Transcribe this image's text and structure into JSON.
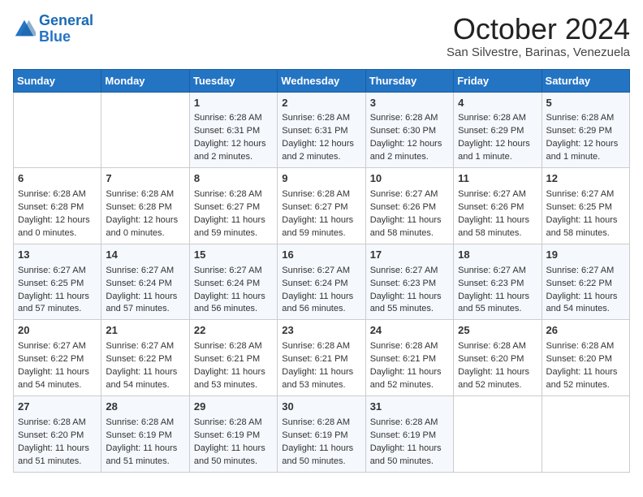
{
  "logo": {
    "line1": "General",
    "line2": "Blue"
  },
  "title": "October 2024",
  "location": "San Silvestre, Barinas, Venezuela",
  "days_header": [
    "Sunday",
    "Monday",
    "Tuesday",
    "Wednesday",
    "Thursday",
    "Friday",
    "Saturday"
  ],
  "weeks": [
    [
      {
        "day": "",
        "data": ""
      },
      {
        "day": "",
        "data": ""
      },
      {
        "day": "1",
        "data": "Sunrise: 6:28 AM\nSunset: 6:31 PM\nDaylight: 12 hours and 2 minutes."
      },
      {
        "day": "2",
        "data": "Sunrise: 6:28 AM\nSunset: 6:31 PM\nDaylight: 12 hours and 2 minutes."
      },
      {
        "day": "3",
        "data": "Sunrise: 6:28 AM\nSunset: 6:30 PM\nDaylight: 12 hours and 2 minutes."
      },
      {
        "day": "4",
        "data": "Sunrise: 6:28 AM\nSunset: 6:29 PM\nDaylight: 12 hours and 1 minute."
      },
      {
        "day": "5",
        "data": "Sunrise: 6:28 AM\nSunset: 6:29 PM\nDaylight: 12 hours and 1 minute."
      }
    ],
    [
      {
        "day": "6",
        "data": "Sunrise: 6:28 AM\nSunset: 6:28 PM\nDaylight: 12 hours and 0 minutes."
      },
      {
        "day": "7",
        "data": "Sunrise: 6:28 AM\nSunset: 6:28 PM\nDaylight: 12 hours and 0 minutes."
      },
      {
        "day": "8",
        "data": "Sunrise: 6:28 AM\nSunset: 6:27 PM\nDaylight: 11 hours and 59 minutes."
      },
      {
        "day": "9",
        "data": "Sunrise: 6:28 AM\nSunset: 6:27 PM\nDaylight: 11 hours and 59 minutes."
      },
      {
        "day": "10",
        "data": "Sunrise: 6:27 AM\nSunset: 6:26 PM\nDaylight: 11 hours and 58 minutes."
      },
      {
        "day": "11",
        "data": "Sunrise: 6:27 AM\nSunset: 6:26 PM\nDaylight: 11 hours and 58 minutes."
      },
      {
        "day": "12",
        "data": "Sunrise: 6:27 AM\nSunset: 6:25 PM\nDaylight: 11 hours and 58 minutes."
      }
    ],
    [
      {
        "day": "13",
        "data": "Sunrise: 6:27 AM\nSunset: 6:25 PM\nDaylight: 11 hours and 57 minutes."
      },
      {
        "day": "14",
        "data": "Sunrise: 6:27 AM\nSunset: 6:24 PM\nDaylight: 11 hours and 57 minutes."
      },
      {
        "day": "15",
        "data": "Sunrise: 6:27 AM\nSunset: 6:24 PM\nDaylight: 11 hours and 56 minutes."
      },
      {
        "day": "16",
        "data": "Sunrise: 6:27 AM\nSunset: 6:24 PM\nDaylight: 11 hours and 56 minutes."
      },
      {
        "day": "17",
        "data": "Sunrise: 6:27 AM\nSunset: 6:23 PM\nDaylight: 11 hours and 55 minutes."
      },
      {
        "day": "18",
        "data": "Sunrise: 6:27 AM\nSunset: 6:23 PM\nDaylight: 11 hours and 55 minutes."
      },
      {
        "day": "19",
        "data": "Sunrise: 6:27 AM\nSunset: 6:22 PM\nDaylight: 11 hours and 54 minutes."
      }
    ],
    [
      {
        "day": "20",
        "data": "Sunrise: 6:27 AM\nSunset: 6:22 PM\nDaylight: 11 hours and 54 minutes."
      },
      {
        "day": "21",
        "data": "Sunrise: 6:27 AM\nSunset: 6:22 PM\nDaylight: 11 hours and 54 minutes."
      },
      {
        "day": "22",
        "data": "Sunrise: 6:28 AM\nSunset: 6:21 PM\nDaylight: 11 hours and 53 minutes."
      },
      {
        "day": "23",
        "data": "Sunrise: 6:28 AM\nSunset: 6:21 PM\nDaylight: 11 hours and 53 minutes."
      },
      {
        "day": "24",
        "data": "Sunrise: 6:28 AM\nSunset: 6:21 PM\nDaylight: 11 hours and 52 minutes."
      },
      {
        "day": "25",
        "data": "Sunrise: 6:28 AM\nSunset: 6:20 PM\nDaylight: 11 hours and 52 minutes."
      },
      {
        "day": "26",
        "data": "Sunrise: 6:28 AM\nSunset: 6:20 PM\nDaylight: 11 hours and 52 minutes."
      }
    ],
    [
      {
        "day": "27",
        "data": "Sunrise: 6:28 AM\nSunset: 6:20 PM\nDaylight: 11 hours and 51 minutes."
      },
      {
        "day": "28",
        "data": "Sunrise: 6:28 AM\nSunset: 6:19 PM\nDaylight: 11 hours and 51 minutes."
      },
      {
        "day": "29",
        "data": "Sunrise: 6:28 AM\nSunset: 6:19 PM\nDaylight: 11 hours and 50 minutes."
      },
      {
        "day": "30",
        "data": "Sunrise: 6:28 AM\nSunset: 6:19 PM\nDaylight: 11 hours and 50 minutes."
      },
      {
        "day": "31",
        "data": "Sunrise: 6:28 AM\nSunset: 6:19 PM\nDaylight: 11 hours and 50 minutes."
      },
      {
        "day": "",
        "data": ""
      },
      {
        "day": "",
        "data": ""
      }
    ]
  ]
}
